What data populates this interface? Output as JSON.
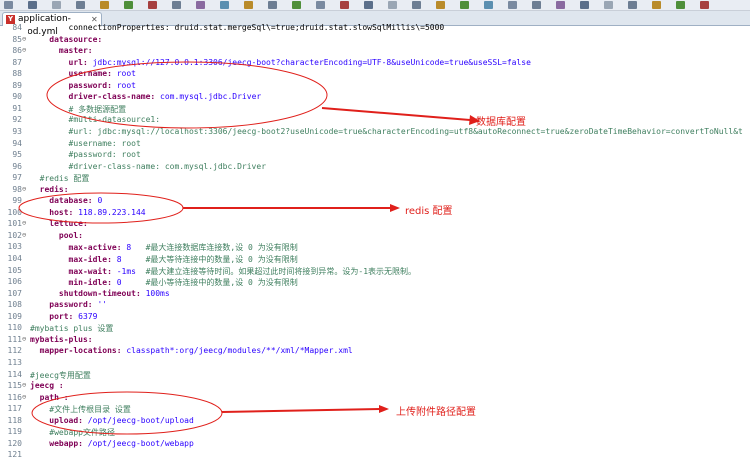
{
  "tab": {
    "label": "application-prod.yml",
    "close": "✕"
  },
  "lines": [
    {
      "n": "84",
      "t": "        connectionProperties: druid.stat.mergeSql\\=true;druid.stat.slowSqlMillis\\=5000",
      "k": "",
      "v": ""
    },
    {
      "n": "85",
      "f": "⊖",
      "k": "    datasource:",
      "v": ""
    },
    {
      "n": "86",
      "f": "⊖",
      "k": "      master:",
      "v": ""
    },
    {
      "n": "87",
      "k": "        url:",
      "v": " jdbc:mysql://127.0.0.1:3306/jeecg-boot?characterEncoding=UTF-8&useUnicode=true&useSSL=false"
    },
    {
      "n": "88",
      "k": "        username:",
      "v": " root"
    },
    {
      "n": "89",
      "k": "        password:",
      "v": " root"
    },
    {
      "n": "90",
      "k": "        driver-class-name:",
      "v": " com.mysql.jdbc.Driver"
    },
    {
      "n": "91",
      "c": "        # 多数据源配置"
    },
    {
      "n": "92",
      "c": "        #multi-datasource1:"
    },
    {
      "n": "93",
      "c": "        #url: jdbc:mysql://localhost:3306/jeecg-boot2?useUnicode=true&characterEncoding=utf8&autoReconnect=true&zeroDateTimeBehavior=convertToNull&t"
    },
    {
      "n": "94",
      "c": "        #username: root"
    },
    {
      "n": "95",
      "c": "        #password: root"
    },
    {
      "n": "96",
      "c": "        #driver-class-name: com.mysql.jdbc.Driver"
    },
    {
      "n": "97",
      "c": "  #redis 配置"
    },
    {
      "n": "98",
      "f": "⊖",
      "k": "  redis:",
      "v": ""
    },
    {
      "n": "99",
      "k": "    database:",
      "v": " 0"
    },
    {
      "n": "100",
      "k": "    host:",
      "v": " 118.89.223.144"
    },
    {
      "n": "101",
      "f": "⊖",
      "k": "    lettuce:",
      "v": ""
    },
    {
      "n": "102",
      "f": "⊖",
      "k": "      pool:",
      "v": ""
    },
    {
      "n": "103",
      "k": "        max-active:",
      "v": " 8   ",
      "c": "#最大连接数据库连接数,设 0 为没有限制"
    },
    {
      "n": "104",
      "k": "        max-idle:",
      "v": " 8     ",
      "c": "#最大等待连接中的数量,设 0 为没有限制"
    },
    {
      "n": "105",
      "k": "        max-wait:",
      "v": " -1ms  ",
      "c": "#最大建立连接等待时间。如果超过此时间将接到异常。设为-1表示无限制。"
    },
    {
      "n": "106",
      "k": "        min-idle:",
      "v": " 0     ",
      "c": "#最小等待连接中的数量,设 0 为没有限制"
    },
    {
      "n": "107",
      "k": "      shutdown-timeout:",
      "v": " 100ms"
    },
    {
      "n": "108",
      "k": "    password:",
      "v": " ''"
    },
    {
      "n": "109",
      "k": "    port:",
      "v": " 6379"
    },
    {
      "n": "110",
      "c": "#mybatis plus 设置"
    },
    {
      "n": "111",
      "f": "⊖",
      "k": "mybatis-plus:",
      "v": ""
    },
    {
      "n": "112",
      "k": "  mapper-locations:",
      "v": " classpath*:org/jeecg/modules/**/xml/*Mapper.xml"
    },
    {
      "n": "113",
      "k": "",
      "v": ""
    },
    {
      "n": "114",
      "c": "#jeecg专用配置"
    },
    {
      "n": "115",
      "f": "⊖",
      "k": "jeecg :",
      "v": ""
    },
    {
      "n": "116",
      "f": "⊖",
      "k": "  path :",
      "v": ""
    },
    {
      "n": "117",
      "c": "    #文件上传根目录 设置"
    },
    {
      "n": "118",
      "k": "    upload:",
      "v": " /opt/jeecg-boot/upload"
    },
    {
      "n": "119",
      "c": "    #webapp文件路径"
    },
    {
      "n": "120",
      "k": "    webapp:",
      "v": " /opt/jeecg-boot/webapp"
    },
    {
      "n": "121",
      "k": "",
      "v": ""
    }
  ],
  "annotations": {
    "db": "数据库配置",
    "redis": "redis 配置",
    "upload": "上传附件路径配置"
  },
  "colors": {
    "annotation": "#e0201b",
    "key": "#7f0055",
    "value": "#2a00ff",
    "comment": "#3f7f5f"
  }
}
